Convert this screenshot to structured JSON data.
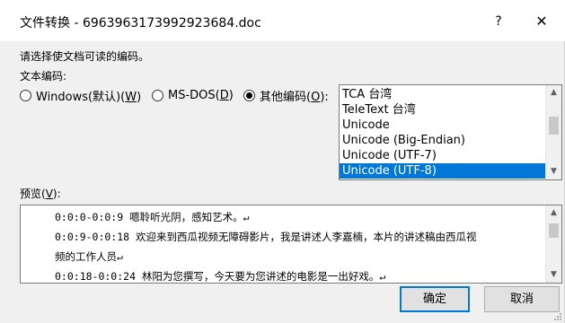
{
  "window": {
    "title": "文件转换 - 6963963173992923684.doc",
    "help_label": "?",
    "close_label": "✕"
  },
  "prompt": "请选择使文档可读的编码。",
  "encoding": {
    "label": "文本编码:",
    "options": [
      {
        "label": "Windows(默认)(",
        "key": "W",
        "suffix": ")",
        "checked": false
      },
      {
        "label": "MS-DOS(",
        "key": "D",
        "suffix": ")",
        "checked": false
      },
      {
        "label": "其他编码(",
        "key": "O",
        "suffix": "):",
        "checked": true
      }
    ],
    "list": {
      "items": [
        "TCA 台湾",
        "TeleText 台湾",
        "Unicode",
        "Unicode (Big-Endian)",
        "Unicode (UTF-7)",
        "Unicode (UTF-8)"
      ],
      "selected": "Unicode (UTF-8)"
    }
  },
  "preview": {
    "label": "预览(",
    "key": "V",
    "suffix": "):",
    "lines": [
      "0:0:0-0:0:9 嗯聆听光阴，感知艺术。↵",
      "0:0:9-0:0:18 欢迎来到西瓜视频无障碍影片，我是讲述人李嘉楠，本片的讲述稿由西瓜视",
      "频的工作人员↵",
      "0:0:18-0:0:24 林阳为您撰写，今天要为您讲述的电影是一出好戏。↵"
    ]
  },
  "buttons": {
    "ok": "确定",
    "cancel": "取消"
  },
  "icons": {
    "scroll_up": "▲",
    "scroll_down": "▼",
    "grip": "resize-grip"
  }
}
